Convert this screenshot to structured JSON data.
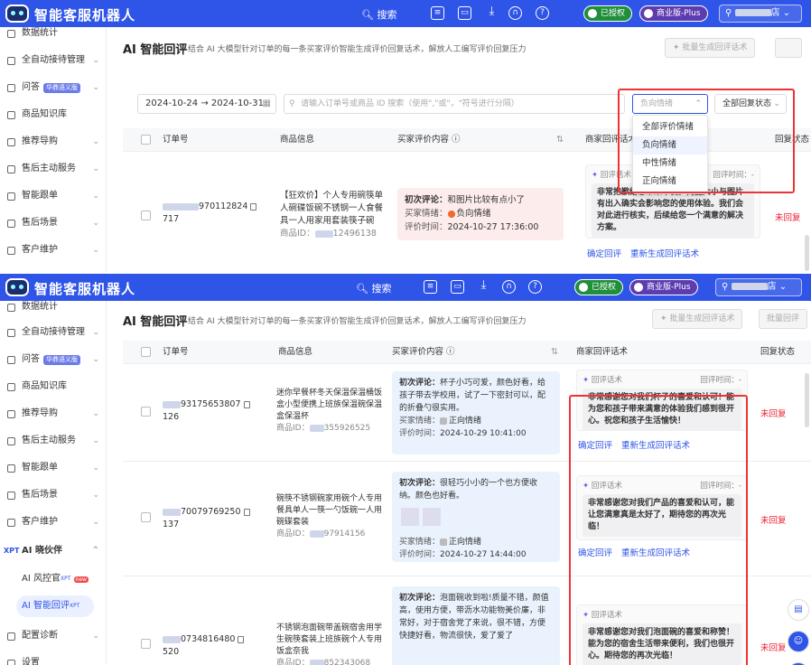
{
  "app": {
    "brand": "智能客服机器人"
  },
  "topbar": {
    "search_label": "搜索",
    "auth_label": "已授权",
    "plan_label": "商业版-Plus",
    "user_label": "店"
  },
  "sidebar_a": [
    "数据统计",
    "全自动接待管理",
    "问答",
    "商品知识库",
    "推荐导购",
    "售后主动服务",
    "智能跟单",
    "售后场景",
    "客户维护"
  ],
  "sidebar_b": [
    "数据统计",
    "全自动接待管理",
    "问答",
    "商品知识库",
    "推荐导购",
    "售后主动服务",
    "智能跟单",
    "售后场景",
    "客户维护"
  ],
  "qa_badge": "华鼎语义版",
  "ai_section": {
    "title": "AI 晓伙伴",
    "xpt": "XPT",
    "items": [
      {
        "label": "AI 风控官",
        "sup": "XPT",
        "new": "new"
      },
      {
        "label": "AI 智能回评",
        "sup": "XPT"
      }
    ],
    "more": [
      "配置诊断",
      "设置"
    ]
  },
  "page": {
    "title": "AI 智能回评",
    "desc": "结合 AI 大模型针对订单的每一条买家评价智能生成评价回复话术，解放人工编写评价回复压力",
    "btn_batch": "批量生成回评话术",
    "btn_batch2": "批量回评"
  },
  "filters": {
    "date_start": "2024-10-24",
    "date_sep": "→",
    "date_end": "2024-10-31",
    "search_placeholder": "请输入订单号或商品 ID 搜索（使用\",\"或\"，\"符号进行分隔）",
    "sentiment_value": "负向情绪",
    "reply_status": "全部回复状态"
  },
  "dropdown": {
    "options": [
      "全部评价情绪",
      "负向情绪",
      "中性情绪",
      "正向情绪"
    ],
    "selected": "负向情绪"
  },
  "columns": {
    "order": "订单号",
    "product": "商品信息",
    "review": "买家评价内容",
    "reply": "商家回评话术",
    "status": "回复状态"
  },
  "labels": {
    "first_review": "初次评论：",
    "buyer_emotion": "买家情绪：",
    "review_time": "评价时间：",
    "product_id": "商品ID：",
    "reply_tag": "回评话术",
    "reply_time": "回评时间：-",
    "confirm": "确定回评",
    "regen": "重新生成回评话术",
    "unreplied": "未回复"
  },
  "rows_a": [
    {
      "order_tail": "970112824",
      "order_line2": "717",
      "product": "【狂欢价】个人专用碗筷单人碗碟饭碗不锈钢一人食餐具一人用家用套装筷子碗",
      "product_id_tail": "12496138",
      "review": "和图片比较有点小了",
      "emotion": "负向情绪",
      "time": "2024-10-27 17:36:00",
      "reply": "非常抱歉给您带来不便。商品大小与图片有出入确实会影响您的使用体验。我们会对此进行核实，后续给您一个满意的解决方案。"
    }
  ],
  "rows_b": [
    {
      "order_tail": "93175653807",
      "order_line2": "126",
      "product": "迷你早餐杯冬天保温保温桶饭盒小型便携上班族保温碗保温盒保温杯",
      "product_id_tail": "355926525",
      "review": "杯子小巧可爱，颜色好看，给孩子带去学校用，试了一下密封可以，配的折叠勺很实用。",
      "emotion": "正向情绪",
      "time": "2024-10-29 10:41:00",
      "reply": "非常感谢您对我们杯子的喜爱和认可！能为您和孩子带来满意的体验我们感到很开心。祝您和孩子生活愉快！"
    },
    {
      "order_tail": "70079769250",
      "order_line2": "137",
      "product": "碗筷不锈钢碗家用碗个人专用餐具单人一筷一勺饭碗一人用碗碟套装",
      "product_id_tail": "97914156",
      "review": "很轻巧小小的一个也方便收纳。颜色也好看。",
      "emotion": "正向情绪",
      "time": "2024-10-27 14:44:00",
      "reply": "非常感谢您对我们产品的喜爱和认可，能让您满意真是太好了，期待您的再次光临！"
    },
    {
      "order_tail": "0734816480",
      "order_line2": "520",
      "product": "不锈钢泡面碗带盖碗宿舍用学生碗筷套装上班族碗个人专用饭盒奈我",
      "product_id_tail": "852343068",
      "review": "泡面碗收到啦!质量不错，颜值高，使用方便，带沥水功能物美价廉，非常好，对于宿舍党了来说，很不错，方便快捷好看，物流很快，爱了爱了",
      "emotion": "正向情绪",
      "time": "",
      "reply": "非常感谢您对我们泡面碗的喜爱和称赞！能为您的宿舍生活带来便利，我们也很开心。期待您的再次光临！"
    }
  ],
  "colors": {
    "primary": "#2f55e8",
    "danger": "#e33",
    "negative_bg": "#fdecec",
    "positive_bg": "#eaf3fd"
  },
  "watermark": "吕文婷 1770"
}
